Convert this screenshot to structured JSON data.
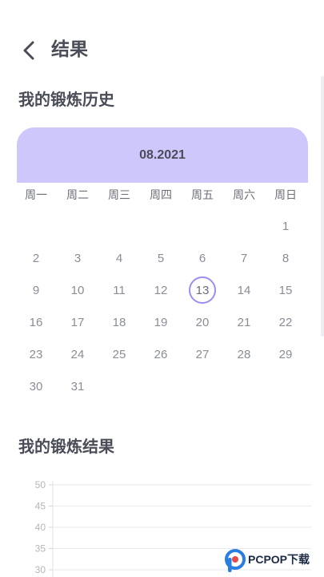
{
  "header": {
    "back_icon": "chevron-left-icon",
    "title": "结果"
  },
  "history": {
    "title": "我的锻炼历史"
  },
  "calendar": {
    "accent_color": "#cdc7fb",
    "selected_ring_color": "#9a8ff0",
    "month_label": "08.2021",
    "weekdays": [
      "周一",
      "周二",
      "周三",
      "周四",
      "周五",
      "周六",
      "周日"
    ],
    "leading_blank_days": 6,
    "days": [
      "1",
      "2",
      "3",
      "4",
      "5",
      "6",
      "7",
      "8",
      "9",
      "10",
      "11",
      "12",
      "13",
      "14",
      "15",
      "16",
      "17",
      "18",
      "19",
      "20",
      "21",
      "22",
      "23",
      "24",
      "25",
      "26",
      "27",
      "28",
      "29",
      "30",
      "31"
    ],
    "selected_day": "13"
  },
  "results": {
    "title": "我的锻炼结果"
  },
  "chart_data": {
    "type": "line",
    "title": "",
    "xlabel": "",
    "ylabel": "",
    "y_ticks": [
      "50",
      "45",
      "40",
      "35",
      "30"
    ],
    "ylim": [
      30,
      50
    ],
    "grid": true,
    "series": []
  },
  "watermark": {
    "text": "PCPOP下载"
  }
}
